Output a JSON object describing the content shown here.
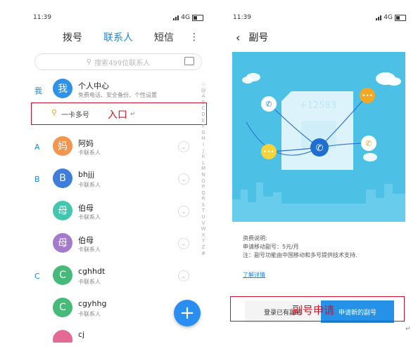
{
  "left": {
    "status": {
      "time": "11:39",
      "net": "4G"
    },
    "tabs": [
      "拨号",
      "联系人",
      "短信"
    ],
    "menu": "⋮",
    "search_placeholder": "搜索499位联系人",
    "self_section": "我",
    "personal_center": {
      "title": "个人中心",
      "subtitle": "免费电话、安全备份、个性设置",
      "avatar_text": "我"
    },
    "one_card": {
      "label": "一卡多号",
      "annotation": "入口"
    },
    "contacts": [
      {
        "section": "A",
        "name": "阿妈",
        "sub": "卡联系人",
        "avatar": "妈",
        "color": "#f08a3c"
      },
      {
        "section": "B",
        "name": "bhjjj",
        "sub": "卡联系人",
        "avatar": "B",
        "color": "#2a6fd6"
      },
      {
        "section": "",
        "name": "伯母",
        "sub": "卡联系人",
        "avatar": "母",
        "color": "#2ec0a6"
      },
      {
        "section": "",
        "name": "伯母",
        "sub": "卡联系人",
        "avatar": "母",
        "color": "#9b6cc7"
      },
      {
        "section": "C",
        "name": "cghhdt",
        "sub": "卡联系人",
        "avatar": "C",
        "color": "#33b36b"
      },
      {
        "section": "",
        "name": "cgyhhg",
        "sub": "卡联系人",
        "avatar": "C",
        "color": "#33b36b"
      },
      {
        "section": "",
        "name": "cj",
        "sub": "",
        "avatar": "",
        "color": "#e05a87"
      }
    ],
    "index_letters": [
      "☆",
      "@",
      "A",
      "B",
      "C",
      "D",
      "E",
      "F",
      "G",
      "H",
      "I",
      "J",
      "K",
      "L",
      "M",
      "N",
      "O",
      "P",
      "Q",
      "R",
      "S",
      "T",
      "U",
      "V",
      "W",
      "X",
      "Y",
      "Z",
      "#"
    ],
    "fab_label": "+"
  },
  "right": {
    "status": {
      "time": "11:39",
      "net": "4G"
    },
    "title": "副号",
    "card_number": "+12583",
    "fee_label": "资费说明:",
    "fee_line": "申请移动副号：5元/月",
    "note": "注：副号功能由中国移动和多号提供技术支持.",
    "details_link": "了解详情",
    "btn_login": "登录已有副号",
    "btn_apply": "申请新的副号",
    "annotation": "副号申请"
  },
  "colors": {
    "accent": "#1a86e6",
    "annotation_red": "#d41022",
    "illustration_bg": "#4cc1e5"
  }
}
